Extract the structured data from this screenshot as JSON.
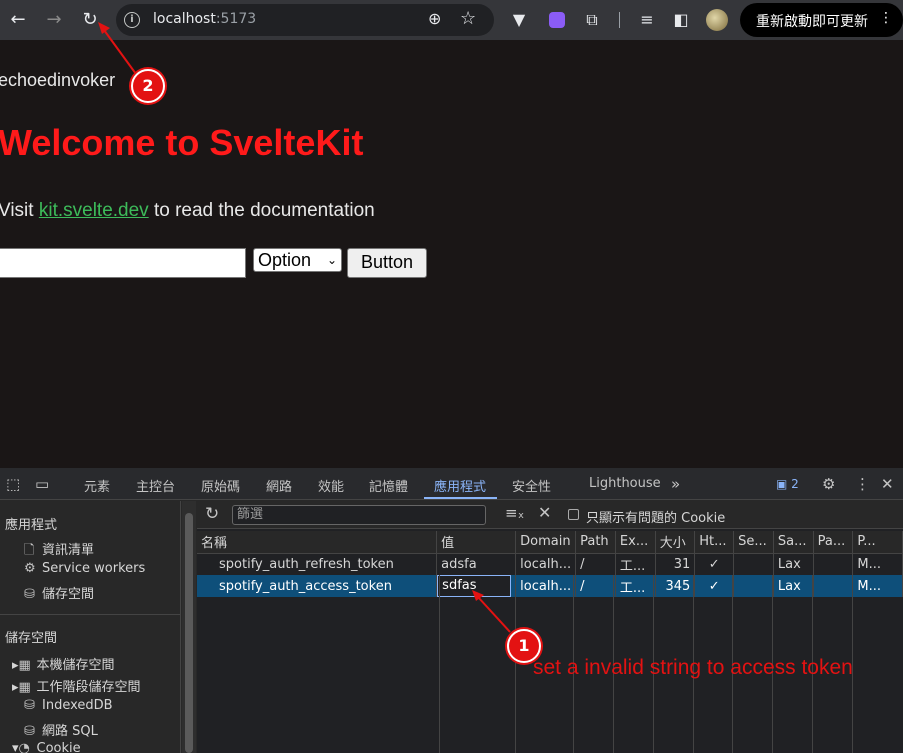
{
  "browser": {
    "url_host": "localhost",
    "url_port": ":5173",
    "update_button": "重新啟動即可更新"
  },
  "page": {
    "username": "echoedinvoker",
    "heading": "Welcome to SvelteKit",
    "visit_prefix": "Visit ",
    "visit_link": "kit.svelte.dev",
    "visit_suffix": " to read the documentation",
    "select_value": "Option",
    "button_label": "Button"
  },
  "devtools": {
    "tabs": [
      "元素",
      "主控台",
      "原始碼",
      "網路",
      "效能",
      "記憶體",
      "應用程式",
      "安全性",
      "Lighthouse"
    ],
    "active_tab": "應用程式",
    "issues_count": "2",
    "sidebar": {
      "application_header": "應用程式",
      "application_items": [
        "資訊清單",
        "Service workers",
        "儲存空間"
      ],
      "storage_header": "儲存空間",
      "storage_items": [
        "本機儲存空間",
        "工作階段儲存空間",
        "IndexedDB",
        "網路 SQL",
        "Cookie"
      ]
    },
    "filter_placeholder": "篩選",
    "only_issues_label": "只顯示有問題的 Cookie",
    "columns": [
      "名稱",
      "值",
      "Domain",
      "Path",
      "Ex...",
      "大小",
      "Ht...",
      "Se...",
      "Sa...",
      "Pa...",
      "P..."
    ],
    "rows": [
      {
        "name": "spotify_auth_refresh_token",
        "value": "adsfa",
        "domain": "localh...",
        "path": "/",
        "expires": "工...",
        "size": "31",
        "httponly": "✓",
        "secure": "",
        "samesite": "Lax",
        "partition": "",
        "priority": "M..."
      },
      {
        "name": "spotify_auth_access_token",
        "value": "sdfas",
        "domain": "localh...",
        "path": "/",
        "expires": "工...",
        "size": "345",
        "httponly": "✓",
        "secure": "",
        "samesite": "Lax",
        "partition": "",
        "priority": "M..."
      }
    ]
  },
  "annotations": {
    "marker_1": "1",
    "marker_2": "2",
    "note": "set a invalid string to access token",
    "color": "#e31212"
  }
}
